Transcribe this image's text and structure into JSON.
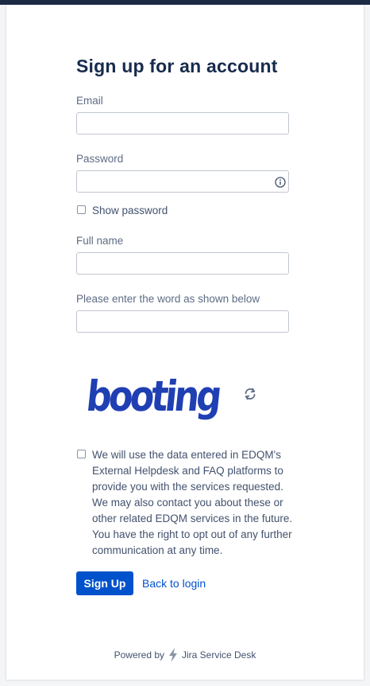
{
  "form": {
    "title": "Sign up for an account",
    "email_label": "Email",
    "email_value": "",
    "password_label": "Password",
    "password_value": "",
    "show_password_label": "Show password",
    "fullname_label": "Full name",
    "fullname_value": "",
    "captcha_label": "Please enter the word as shown below",
    "captcha_value": "",
    "captcha_word": "booting",
    "consent_text": "We will use the data entered in EDQM's External Helpdesk and FAQ platforms to provide you with the services requested. We may also contact you about these or other related EDQM services in the future. You have the right to opt out of any further communication at any time.",
    "signup_label": "Sign Up",
    "back_label": "Back to login"
  },
  "footer": {
    "powered_by": "Powered by",
    "product": "Jira Service Desk"
  },
  "colors": {
    "primary": "#0052cc",
    "topbar": "#1d2a44",
    "captcha_text": "#1f3fb3"
  },
  "icons": {
    "password_info": "info-icon",
    "captcha_refresh": "refresh-icon",
    "brand": "jira-bolt-icon"
  }
}
